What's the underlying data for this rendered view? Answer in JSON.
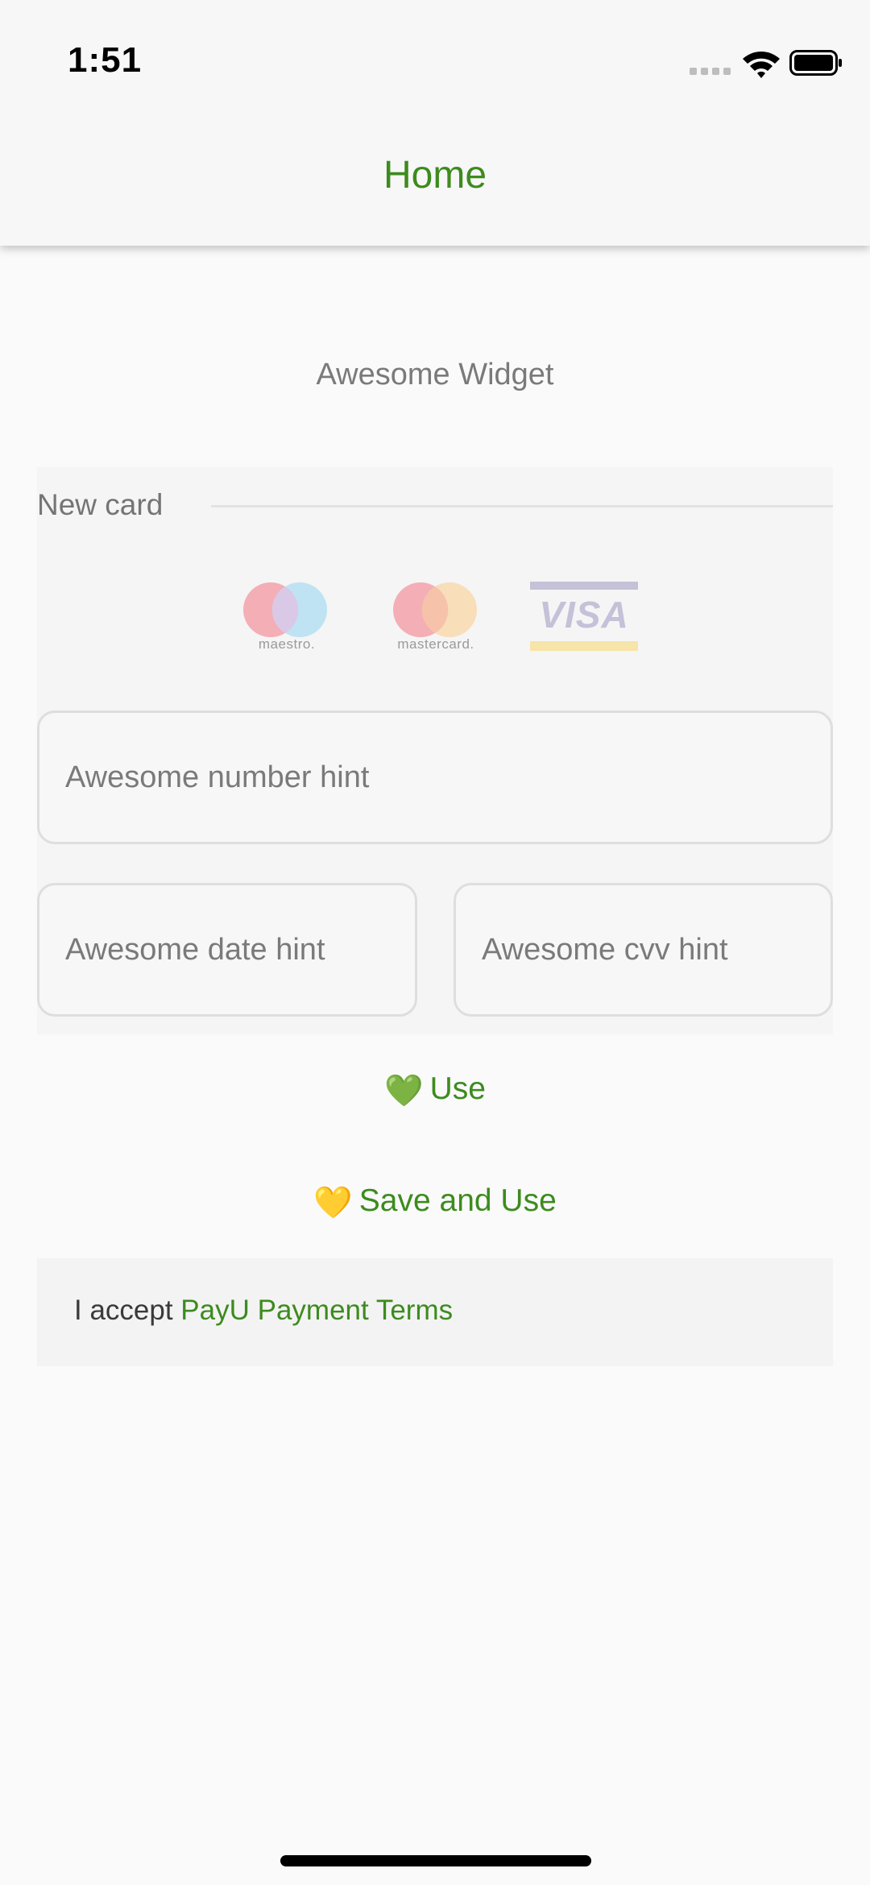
{
  "status_bar": {
    "time": "1:51"
  },
  "app_bar": {
    "title": "Home"
  },
  "widget": {
    "title": "Awesome Widget"
  },
  "card_section": {
    "label": "New card",
    "brands": [
      {
        "name": "maestro",
        "caption": "maestro."
      },
      {
        "name": "mastercard",
        "caption": "mastercard."
      },
      {
        "name": "visa",
        "caption": "VISA"
      }
    ]
  },
  "fields": {
    "number_placeholder": "Awesome number hint",
    "date_placeholder": "Awesome date hint",
    "cvv_placeholder": "Awesome cvv hint"
  },
  "buttons": {
    "use_emoji": "💚",
    "use_label": "Use",
    "save_emoji": "💛",
    "save_label": "Save and Use"
  },
  "terms": {
    "prefix": "I accept ",
    "link": "PayU Payment Terms"
  },
  "colors": {
    "accent": "#3d8b1e",
    "background": "#fafafa"
  }
}
